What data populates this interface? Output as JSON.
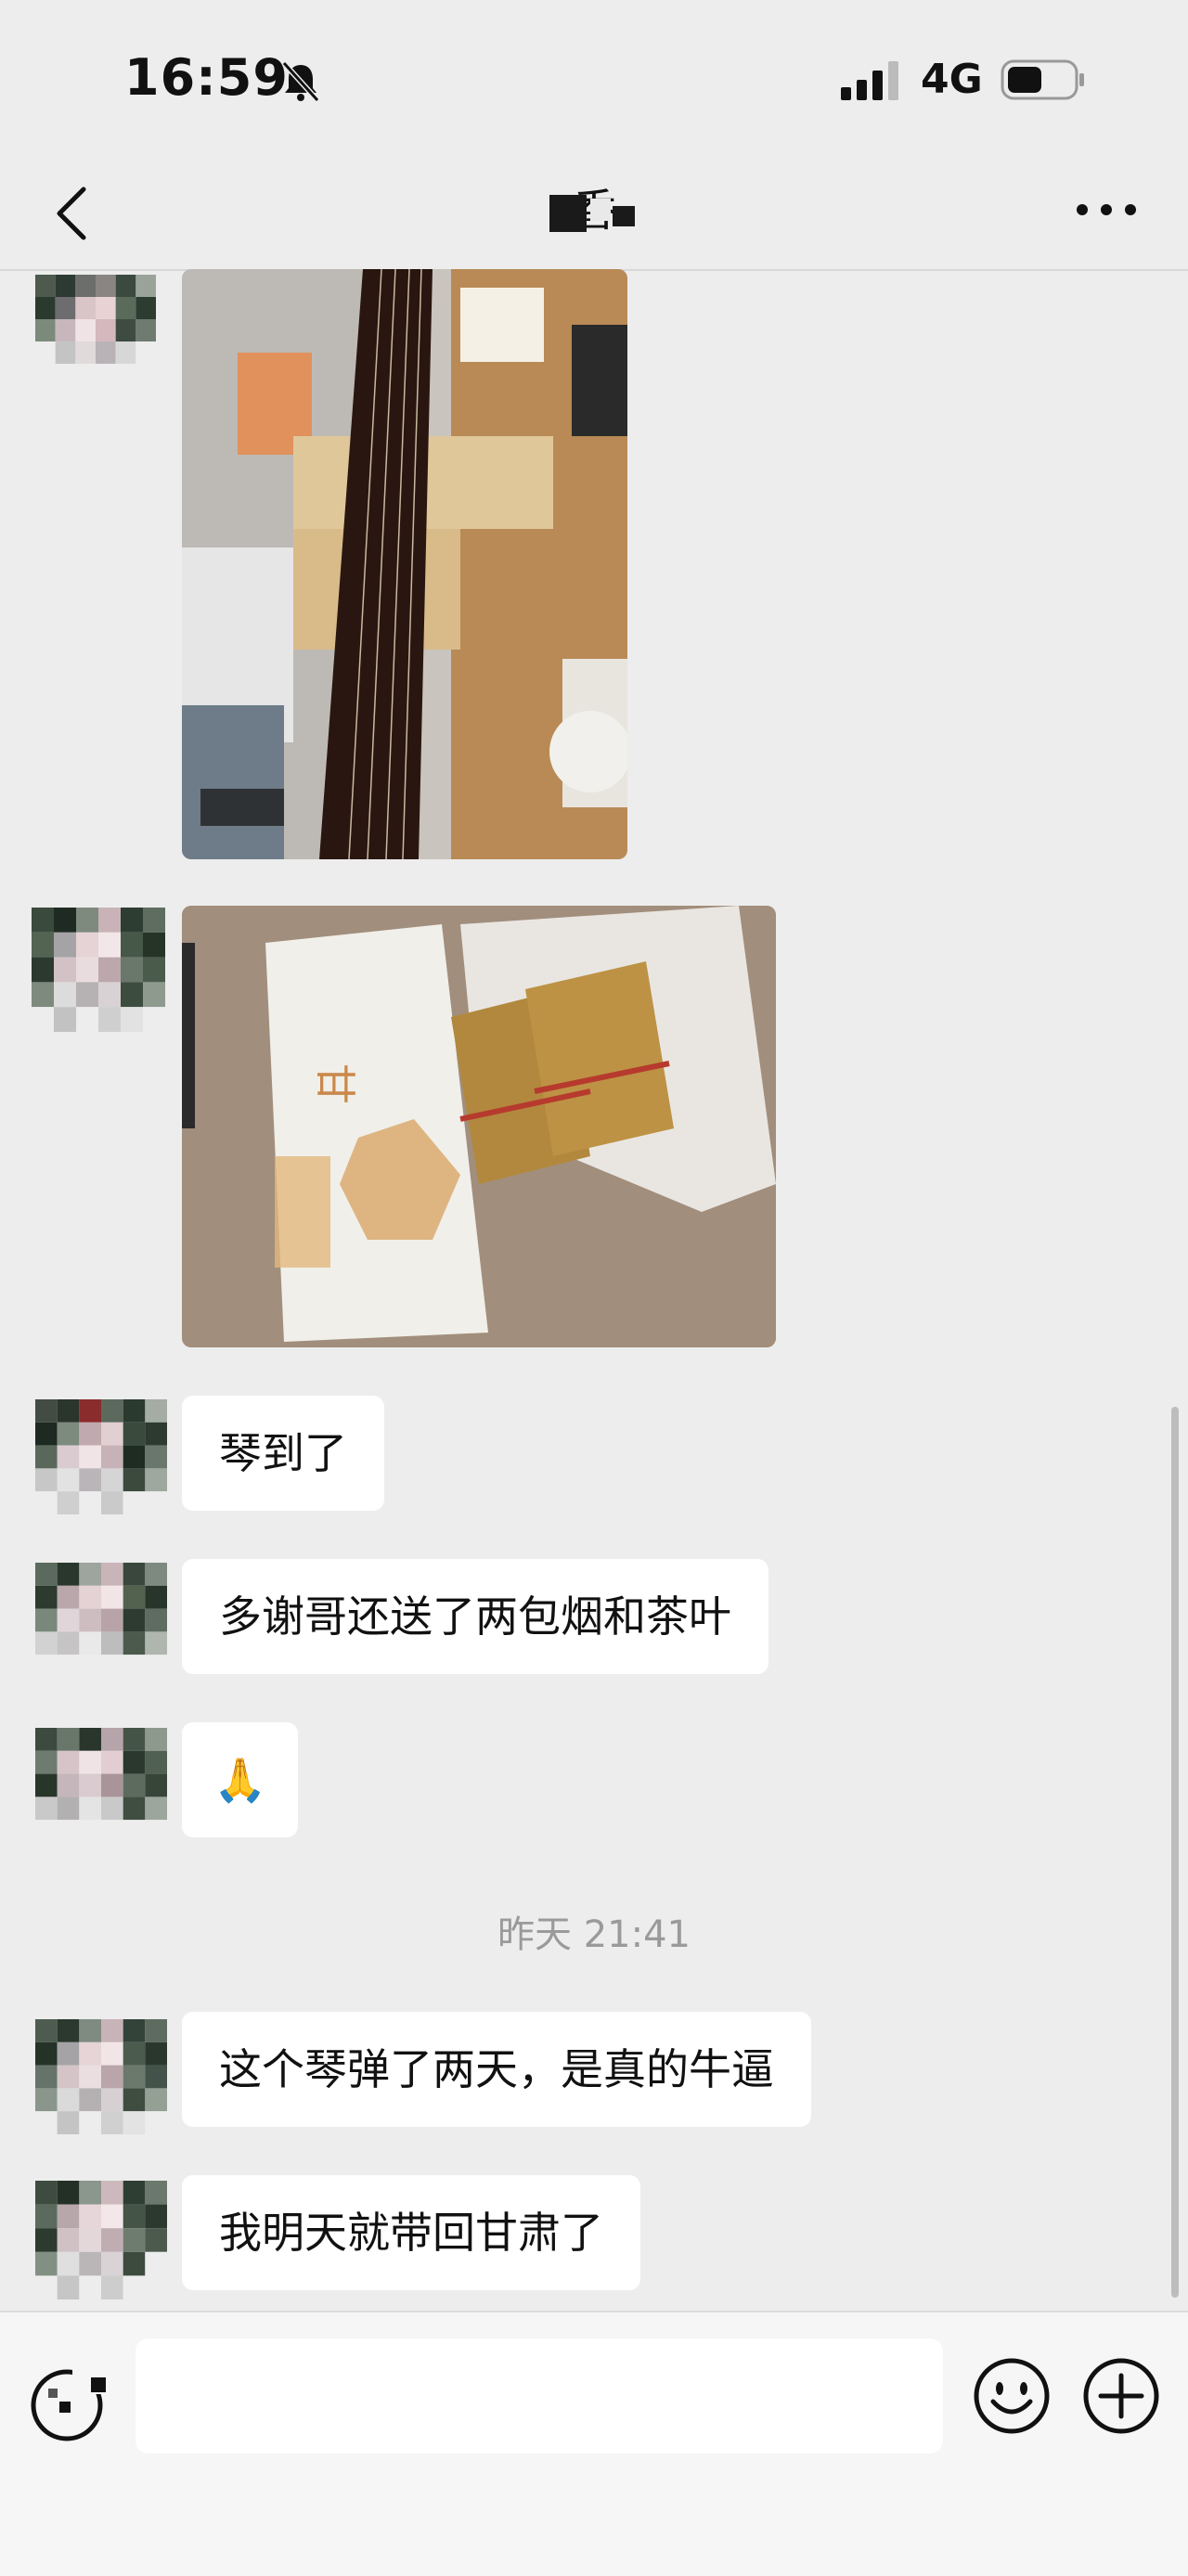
{
  "status_bar": {
    "time": "16:59",
    "network": "4G",
    "icons": [
      "bell-muted-icon",
      "signal-icon",
      "battery-icon"
    ]
  },
  "header": {
    "title": "香",
    "icons": [
      "back-chevron-icon",
      "more-dots-icon"
    ]
  },
  "messages": [
    {
      "type": "image",
      "content": "guqin-photo"
    },
    {
      "type": "image",
      "content": "tea-and-cigarettes-photo"
    },
    {
      "type": "text",
      "text": "琴到了"
    },
    {
      "type": "text",
      "text": "多谢哥还送了两包烟和茶叶"
    },
    {
      "type": "text",
      "text": "🙏"
    },
    {
      "type": "timestamp",
      "text": "昨天 21:41"
    },
    {
      "type": "text",
      "text": "这个琴弹了两天，是真的牛逼"
    },
    {
      "type": "text",
      "text": "我明天就带回甘肃了"
    }
  ],
  "input_bar": {
    "value": "",
    "icons": [
      "voice-icon",
      "emoji-icon",
      "plus-icon"
    ]
  },
  "colors": {
    "background": "#ededed",
    "bubble": "#ffffff",
    "timestamp": "#9a9a9a"
  }
}
